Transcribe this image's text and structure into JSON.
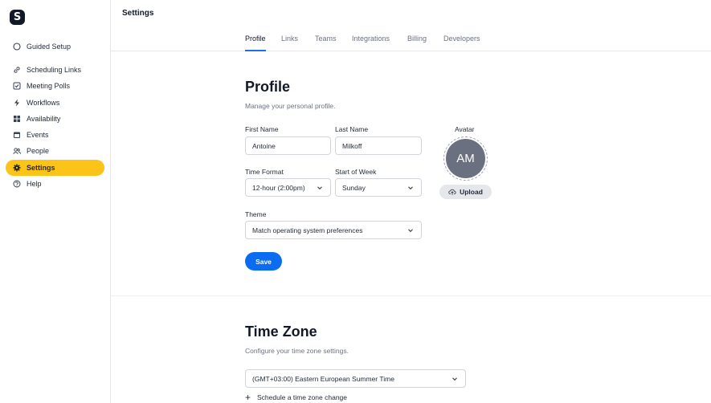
{
  "logo": {
    "letter": "S"
  },
  "sidebar": {
    "items": [
      {
        "label": "Guided Setup",
        "icon": "circle-icon"
      },
      {
        "label": "Scheduling Links",
        "icon": "link-icon"
      },
      {
        "label": "Meeting Polls",
        "icon": "checkbox-icon"
      },
      {
        "label": "Workflows",
        "icon": "bolt-icon"
      },
      {
        "label": "Availability",
        "icon": "grid-icon"
      },
      {
        "label": "Events",
        "icon": "calendar-icon"
      },
      {
        "label": "People",
        "icon": "people-icon"
      },
      {
        "label": "Settings",
        "icon": "gear-icon",
        "active": true
      },
      {
        "label": "Help",
        "icon": "help-icon"
      }
    ]
  },
  "header": {
    "title": "Settings"
  },
  "tabs": [
    {
      "label": "Profile",
      "active": true
    },
    {
      "label": "Links"
    },
    {
      "label": "Teams"
    },
    {
      "label": "Integrations"
    },
    {
      "label": "Billing"
    },
    {
      "label": "Developers"
    }
  ],
  "profile": {
    "title": "Profile",
    "subtitle": "Manage your personal profile.",
    "first_name_label": "First Name",
    "first_name_value": "Antoine",
    "last_name_label": "Last Name",
    "last_name_value": "Milkoff",
    "time_format_label": "Time Format",
    "time_format_value": "12-hour (2:00pm)",
    "start_week_label": "Start of Week",
    "start_week_value": "Sunday",
    "theme_label": "Theme",
    "theme_value": "Match operating system preferences",
    "save_label": "Save",
    "avatar_label": "Avatar",
    "avatar_initials": "AM",
    "upload_label": "Upload"
  },
  "timezone": {
    "title": "Time Zone",
    "subtitle": "Configure your time zone settings.",
    "value": "(GMT+03:00) Eastern European Summer Time",
    "schedule_link": "Schedule a time zone change"
  },
  "colors": {
    "accent": "#0b6cf2",
    "active_nav": "#fcc419",
    "avatar_bg": "#6b7080"
  }
}
